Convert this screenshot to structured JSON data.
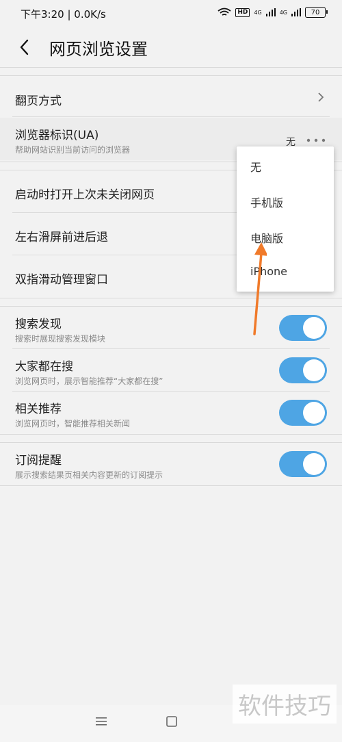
{
  "status": {
    "time": "下午3:20 | 0.0K/s",
    "hd": "HD",
    "net1": "4G",
    "net2": "4G",
    "battery": "70"
  },
  "header": {
    "title": "网页浏览设置"
  },
  "rows": {
    "page_turn": {
      "label": "翻页方式"
    },
    "ua": {
      "label": "浏览器标识(UA)",
      "sub": "帮助网站识别当前访问的浏览器",
      "value": "无"
    },
    "restore": {
      "label": "启动时打开上次未关闭网页"
    },
    "swipe": {
      "label": "左右滑屏前进后退"
    },
    "two_finger": {
      "label": "双指滑动管理窗口"
    },
    "search_discover": {
      "label": "搜索发现",
      "sub": "搜索时展现搜索发现模块",
      "on": true
    },
    "everyone_search": {
      "label": "大家都在搜",
      "sub": "浏览网页时，展示智能推荐“大家都在搜”",
      "on": true
    },
    "related": {
      "label": "相关推荐",
      "sub": "浏览网页时，智能推荐相关新闻",
      "on": true
    },
    "subscribe": {
      "label": "订阅提醒",
      "sub": "展示搜索结果页相关内容更新的订阅提示",
      "on": true
    }
  },
  "ua_menu": {
    "items": [
      "无",
      "手机版",
      "电脑版",
      "iPhone"
    ]
  },
  "colors": {
    "toggle_on": "#4ea5e4",
    "arrow": "#f07a2a"
  },
  "watermark": "软件技巧"
}
